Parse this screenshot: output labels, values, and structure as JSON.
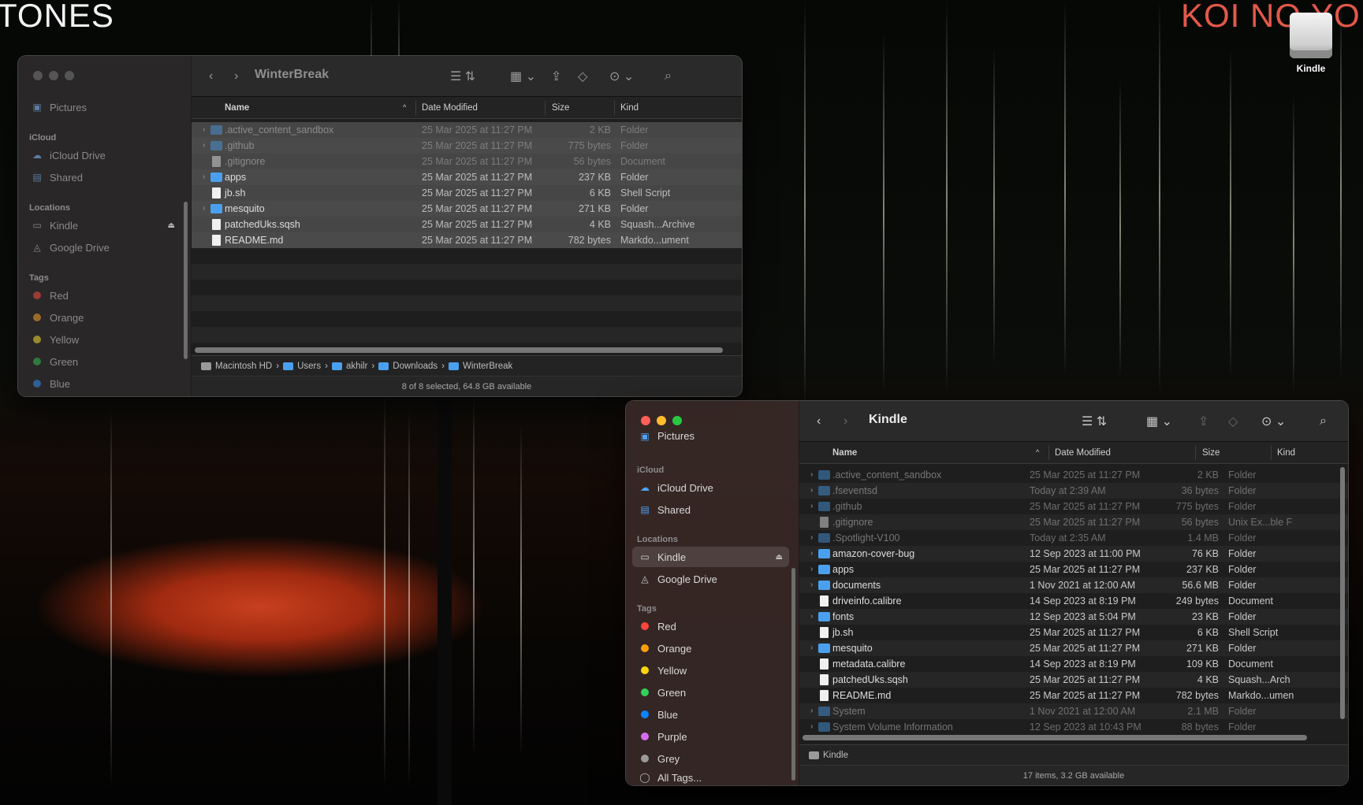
{
  "wallpaper": {
    "left_text": "TONES",
    "right_text": "KOI NO YO"
  },
  "desktop_icon": {
    "label": "Kindle",
    "icon": "external-drive-icon"
  },
  "win1": {
    "title": "WinterBreak",
    "sidebar": {
      "top_item": "Pictures",
      "icloud_heading": "iCloud",
      "icloud": [
        "iCloud Drive",
        "Shared"
      ],
      "locations_heading": "Locations",
      "locations": [
        "Kindle",
        "Google Drive"
      ],
      "tags_heading": "Tags",
      "tags": [
        {
          "label": "Red",
          "color": "#9b3b38"
        },
        {
          "label": "Orange",
          "color": "#9a6a2c"
        },
        {
          "label": "Yellow",
          "color": "#9a8a2c"
        },
        {
          "label": "Green",
          "color": "#2f7a3e"
        },
        {
          "label": "Blue",
          "color": "#2e5f96"
        }
      ]
    },
    "columns": {
      "name": "Name",
      "date": "Date Modified",
      "size": "Size",
      "kind": "Kind"
    },
    "rows": [
      {
        "name": ".active_content_sandbox",
        "date": "25 Mar 2025 at 11:27 PM",
        "size": "2 KB",
        "kind": "Folder"
      },
      {
        "name": ".github",
        "date": "25 Mar 2025 at 11:27 PM",
        "size": "775 bytes",
        "kind": "Folder"
      },
      {
        "name": ".gitignore",
        "date": "25 Mar 2025 at 11:27 PM",
        "size": "56 bytes",
        "kind": "Document"
      },
      {
        "name": "apps",
        "date": "25 Mar 2025 at 11:27 PM",
        "size": "237 KB",
        "kind": "Folder"
      },
      {
        "name": "jb.sh",
        "date": "25 Mar 2025 at 11:27 PM",
        "size": "6 KB",
        "kind": "Shell Script"
      },
      {
        "name": "mesquito",
        "date": "25 Mar 2025 at 11:27 PM",
        "size": "271 KB",
        "kind": "Folder"
      },
      {
        "name": "patchedUks.sqsh",
        "date": "25 Mar 2025 at 11:27 PM",
        "size": "4 KB",
        "kind": "Squash...Archive"
      },
      {
        "name": "README.md",
        "date": "25 Mar 2025 at 11:27 PM",
        "size": "782 bytes",
        "kind": "Markdo...ument"
      }
    ],
    "path": [
      "Macintosh HD",
      "Users",
      "akhilr",
      "Downloads",
      "WinterBreak"
    ],
    "status": "8 of 8 selected, 64.8 GB available"
  },
  "win2": {
    "title": "Kindle",
    "sidebar": {
      "top_item": "Pictures",
      "icloud_heading": "iCloud",
      "icloud": [
        "iCloud Drive",
        "Shared"
      ],
      "locations_heading": "Locations",
      "locations": [
        "Kindle",
        "Google Drive"
      ],
      "tags_heading": "Tags",
      "tags": [
        {
          "label": "Red",
          "color": "#ff453a"
        },
        {
          "label": "Orange",
          "color": "#ff9f0a"
        },
        {
          "label": "Yellow",
          "color": "#ffd60a"
        },
        {
          "label": "Green",
          "color": "#30d158"
        },
        {
          "label": "Blue",
          "color": "#0a84ff"
        },
        {
          "label": "Purple",
          "color": "#d56cf0"
        },
        {
          "label": "Grey",
          "color": "#9a9a9a"
        }
      ],
      "all_tags": "All Tags..."
    },
    "columns": {
      "name": "Name",
      "date": "Date Modified",
      "size": "Size",
      "kind": "Kind"
    },
    "rows": [
      {
        "name": ".active_content_sandbox",
        "date": "25 Mar 2025 at 11:27 PM",
        "size": "2 KB",
        "kind": "Folder"
      },
      {
        "name": ".fseventsd",
        "date": "Today at 2:39 AM",
        "size": "36 bytes",
        "kind": "Folder"
      },
      {
        "name": ".github",
        "date": "25 Mar 2025 at 11:27 PM",
        "size": "775 bytes",
        "kind": "Folder"
      },
      {
        "name": ".gitignore",
        "date": "25 Mar 2025 at 11:27 PM",
        "size": "56 bytes",
        "kind": "Unix Ex...ble F"
      },
      {
        "name": ".Spotlight-V100",
        "date": "Today at 2:35 AM",
        "size": "1.4 MB",
        "kind": "Folder"
      },
      {
        "name": "amazon-cover-bug",
        "date": "12 Sep 2023 at 11:00 PM",
        "size": "76 KB",
        "kind": "Folder"
      },
      {
        "name": "apps",
        "date": "25 Mar 2025 at 11:27 PM",
        "size": "237 KB",
        "kind": "Folder"
      },
      {
        "name": "documents",
        "date": "1 Nov 2021 at 12:00 AM",
        "size": "56.6 MB",
        "kind": "Folder"
      },
      {
        "name": "driveinfo.calibre",
        "date": "14 Sep 2023 at 8:19 PM",
        "size": "249 bytes",
        "kind": "Document"
      },
      {
        "name": "fonts",
        "date": "12 Sep 2023 at 5:04 PM",
        "size": "23 KB",
        "kind": "Folder"
      },
      {
        "name": "jb.sh",
        "date": "25 Mar 2025 at 11:27 PM",
        "size": "6 KB",
        "kind": "Shell Script"
      },
      {
        "name": "mesquito",
        "date": "25 Mar 2025 at 11:27 PM",
        "size": "271 KB",
        "kind": "Folder"
      },
      {
        "name": "metadata.calibre",
        "date": "14 Sep 2023 at 8:19 PM",
        "size": "109 KB",
        "kind": "Document"
      },
      {
        "name": "patchedUks.sqsh",
        "date": "25 Mar 2025 at 11:27 PM",
        "size": "4 KB",
        "kind": "Squash...Arch"
      },
      {
        "name": "README.md",
        "date": "25 Mar 2025 at 11:27 PM",
        "size": "782 bytes",
        "kind": "Markdo...umen"
      },
      {
        "name": "System",
        "date": "1 Nov 2021 at 12:00 AM",
        "size": "2.1 MB",
        "kind": "Folder"
      },
      {
        "name": "System Volume Information",
        "date": "12 Sep 2023 at 10:43 PM",
        "size": "88 bytes",
        "kind": "Folder"
      }
    ],
    "path": [
      "Kindle"
    ],
    "status": "17 items, 3.2 GB available"
  }
}
